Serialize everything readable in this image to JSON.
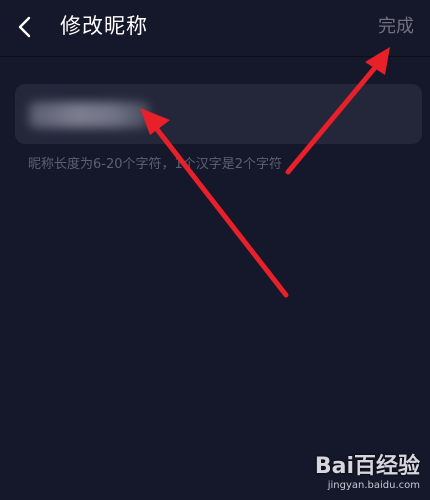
{
  "header": {
    "title": "修改昵称",
    "done_label": "完成",
    "back_icon": "chevron-left-icon"
  },
  "nickname": {
    "hint": "昵称长度为6-20个字符，1个汉字是2个字符"
  },
  "watermark": {
    "logo_text": "Bai百经验",
    "url": "jingyan.baidu.com"
  },
  "colors": {
    "background": "#15172a",
    "input_background": "#24263a",
    "arrow": "#e8202a",
    "disabled_text": "#70727f"
  }
}
